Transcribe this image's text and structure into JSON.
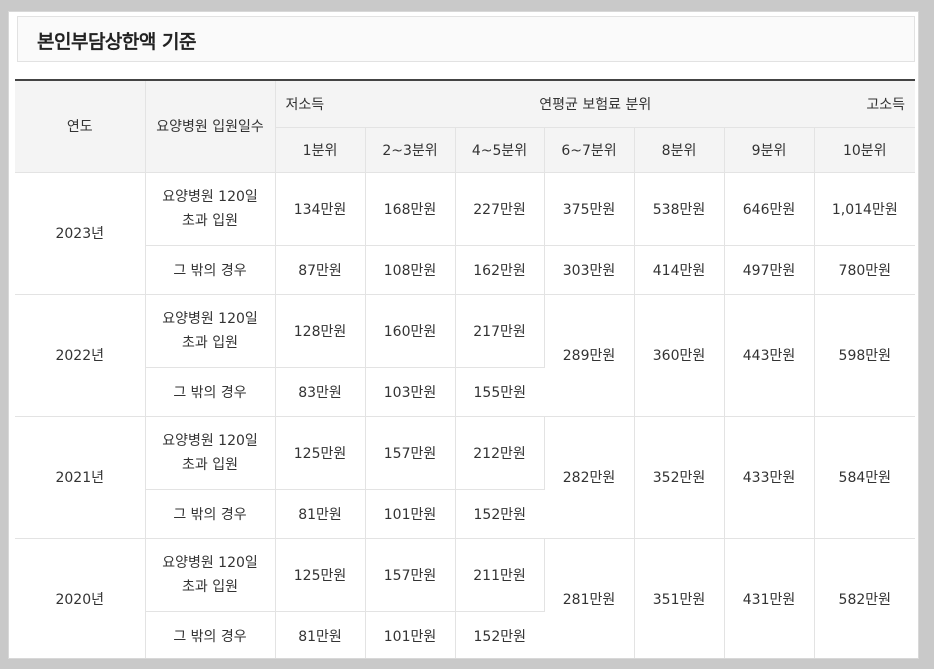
{
  "title": "본인부담상한액 기준",
  "header": {
    "year": "연도",
    "days": "요양병원 입원일수",
    "low": "저소득",
    "middle": "연평균 보험료 분위",
    "high": "고소득",
    "deciles": [
      "1분위",
      "2~3분위",
      "4~5분위",
      "6~7분위",
      "8분위",
      "9분위",
      "10분위"
    ]
  },
  "category": {
    "over120_line1": "요양병원 120일",
    "over120_line2": "초과 입원",
    "other": "그 밖의 경우"
  },
  "rows": {
    "y2023": {
      "year": "2023년",
      "over120": [
        "134만원",
        "168만원",
        "227만원",
        "375만원",
        "538만원",
        "646만원",
        "1,014만원"
      ],
      "other": [
        "87만원",
        "108만원",
        "162만원",
        "303만원",
        "414만원",
        "497만원",
        "780만원"
      ]
    },
    "y2022": {
      "year": "2022년",
      "over120": [
        "128만원",
        "160만원",
        "217만원"
      ],
      "other": [
        "83만원",
        "103만원",
        "155만원"
      ],
      "shared": [
        "289만원",
        "360만원",
        "443만원",
        "598만원"
      ]
    },
    "y2021": {
      "year": "2021년",
      "over120": [
        "125만원",
        "157만원",
        "212만원"
      ],
      "other": [
        "81만원",
        "101만원",
        "152만원"
      ],
      "shared": [
        "282만원",
        "352만원",
        "433만원",
        "584만원"
      ]
    },
    "y2020": {
      "year": "2020년",
      "over120": [
        "125만원",
        "157만원",
        "211만원"
      ],
      "other": [
        "81만원",
        "101만원",
        "152만원"
      ],
      "shared": [
        "281만원",
        "351만원",
        "431만원",
        "582만원"
      ]
    }
  }
}
